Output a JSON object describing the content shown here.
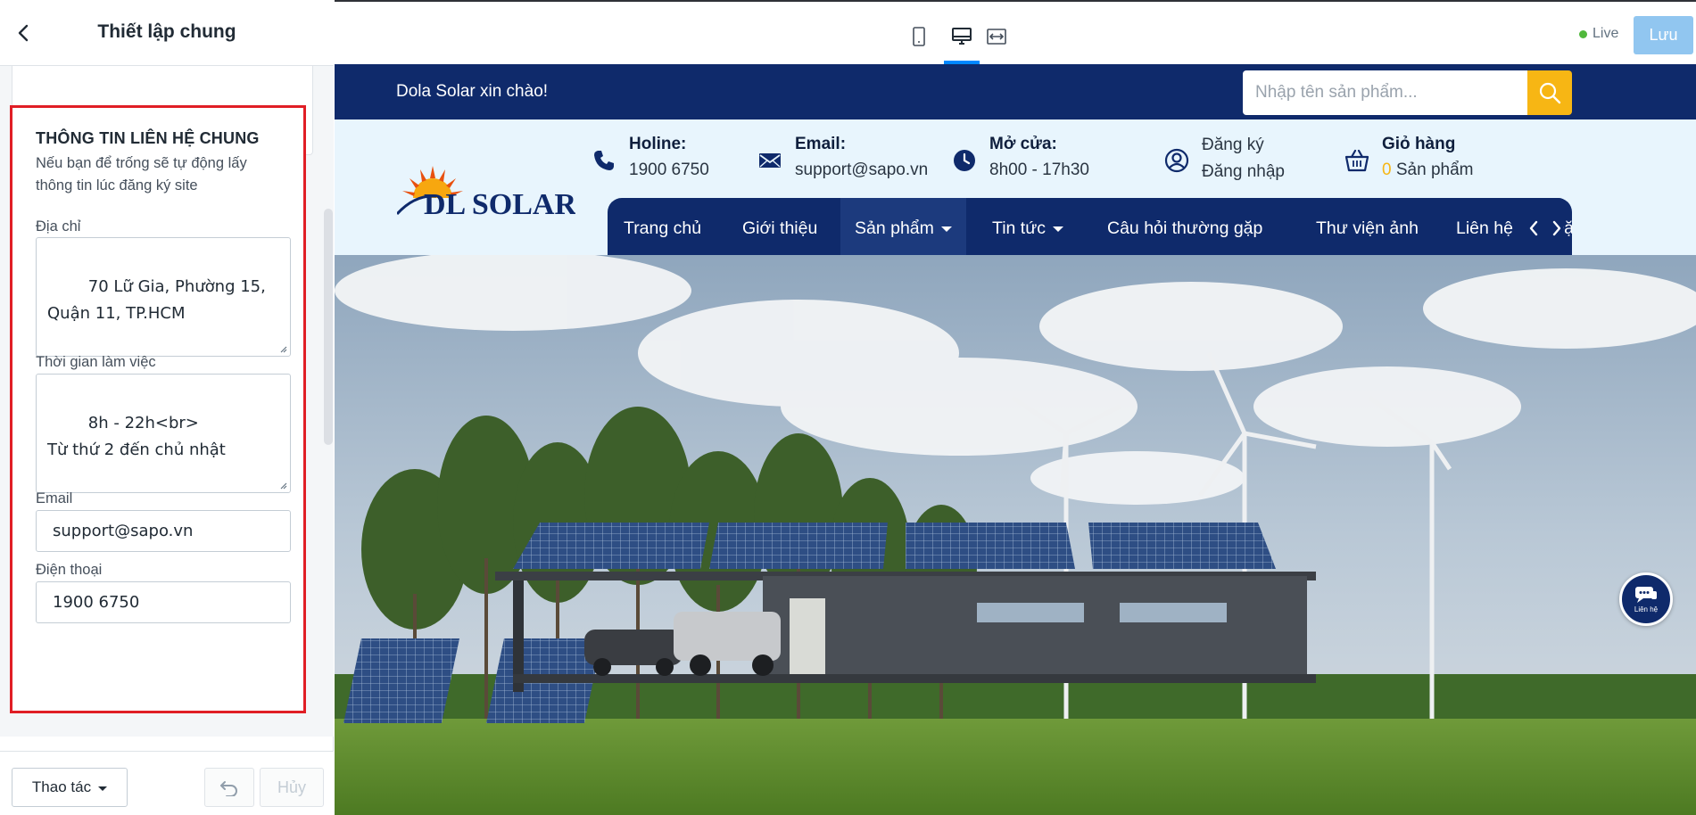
{
  "panel": {
    "title": "Thiết lập chung",
    "section": {
      "title": "THÔNG TIN LIÊN HỆ CHUNG",
      "description": "Nếu bạn để trống sẽ tự động lấy thông tin lúc đăng ký site"
    },
    "fields": {
      "address": {
        "label": "Địa chỉ",
        "value": "70 Lữ Gia, Phường 15, Quận 11, TP.HCM"
      },
      "working_hours": {
        "label": "Thời gian làm việc",
        "value": "8h - 22h<br>\nTừ thứ 2 đến chủ nhật"
      },
      "email": {
        "label": "Email",
        "value": "support@sapo.vn"
      },
      "phone": {
        "label": "Điện thoại",
        "value": "1900 6750"
      }
    },
    "footer": {
      "actions_label": "Thao tác",
      "cancel_label": "Hủy"
    }
  },
  "toolbar": {
    "live_label": "Live",
    "save_label": "Lưu",
    "active_device": "desktop"
  },
  "site": {
    "greeting": "Dola Solar xin chào!",
    "search_placeholder": "Nhập tên sản phẩm...",
    "logo_text": "DL SOLAR",
    "info": {
      "hotline": {
        "title": "Holine:",
        "value": "1900 6750",
        "icon": "phone-icon"
      },
      "email": {
        "title": "Email:",
        "value": "support@sapo.vn",
        "icon": "mail-icon"
      },
      "open": {
        "title": "Mở cửa:",
        "value": "8h00 - 17h30",
        "icon": "clock-icon"
      },
      "account": {
        "line1": "Đăng ký",
        "line2": "Đăng nhập",
        "icon": "user-icon"
      },
      "cart": {
        "title": "Giỏ hàng",
        "count": "0",
        "suffix": " Sản phẩm",
        "icon": "cart-icon"
      }
    },
    "nav": [
      {
        "label": "Trang chủ"
      },
      {
        "label": "Giới thiệu"
      },
      {
        "label": "Sản phẩm",
        "dropdown": true
      },
      {
        "label": "Tin tức",
        "dropdown": true
      },
      {
        "label": "Câu hỏi thường gặp"
      },
      {
        "label": "Thư viện ảnh"
      },
      {
        "label": "Liên hệ"
      },
      {
        "label": "Đặt"
      }
    ],
    "chat_label": "Liên hệ"
  },
  "colors": {
    "brand_navy": "#0f2a6b",
    "accent_yellow": "#f7b614",
    "highlight_red": "#e01e25",
    "save_blue": "#91c6f0"
  }
}
